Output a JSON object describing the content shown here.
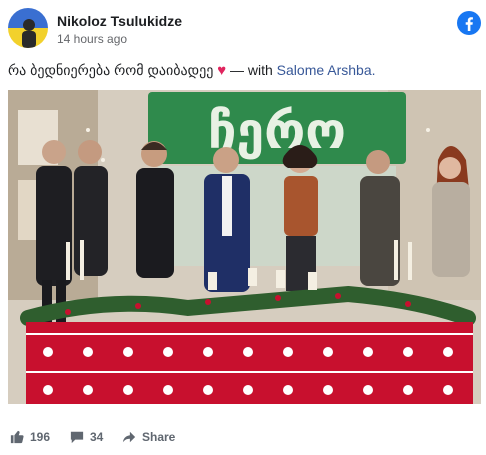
{
  "post": {
    "author": "Nikoloz Tsulukidze",
    "time": "14 hours ago",
    "text": "რა ბედნიერება რომ დაიბადეე",
    "heart": "♥",
    "with_prefix": "— with",
    "tagged": "Salome Arshba."
  },
  "photo": {
    "backdrop_sign": "ჩერო"
  },
  "footer": {
    "likes": "196",
    "comments": "34",
    "share_label": "Share"
  },
  "colors": {
    "facebook_blue": "#1877f2",
    "link": "#385898",
    "muted": "#606770",
    "sign_green": "#2f8a4c",
    "tablecloth_red": "#c8102e"
  },
  "icons": [
    "facebook-logo-icon",
    "like-icon",
    "comment-icon",
    "share-icon"
  ]
}
